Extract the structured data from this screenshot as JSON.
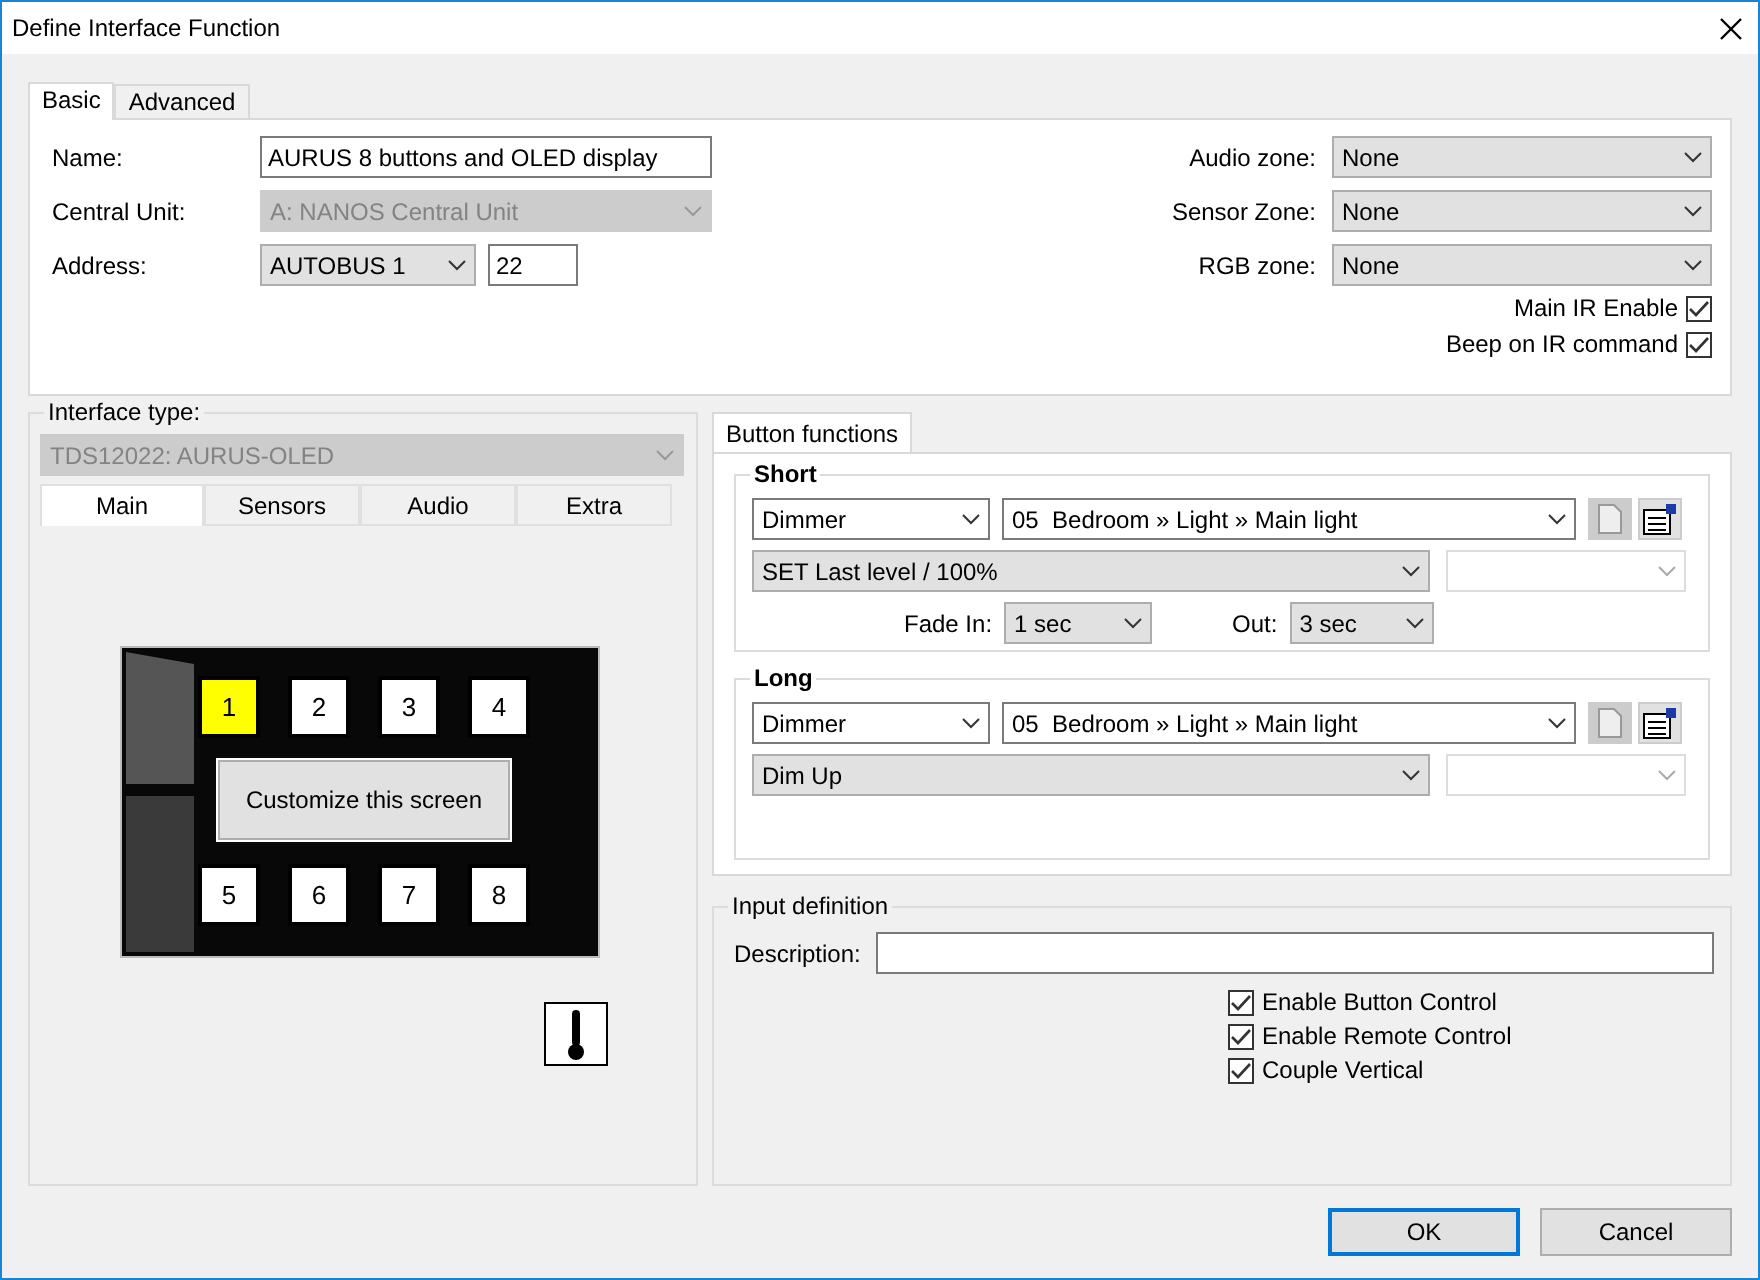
{
  "window": {
    "title": "Define Interface Function"
  },
  "tabs": [
    {
      "label": "Basic",
      "selected": true
    },
    {
      "label": "Advanced",
      "selected": false
    }
  ],
  "general": {
    "name": {
      "label": "Name:",
      "value": "AURUS 8 buttons and OLED display"
    },
    "central_unit": {
      "label": "Central Unit:",
      "value": "A: NANOS Central Unit",
      "disabled": true
    },
    "address": {
      "label": "Address:",
      "bus": "AUTOBUS 1",
      "number": "22"
    }
  },
  "zones": [
    {
      "label": "Audio zone:",
      "value": "None"
    },
    {
      "label": "Sensor Zone:",
      "value": "None"
    },
    {
      "label": "RGB zone:",
      "value": "None"
    }
  ],
  "options": [
    {
      "label": "Main IR Enable",
      "checked": true
    },
    {
      "label": "Beep on IR command",
      "checked": true
    }
  ],
  "interface_type": {
    "legend": "Interface type:",
    "value": "TDS12022: AURUS-OLED",
    "disabled": true
  },
  "device_tabs": [
    {
      "label": "Main",
      "selected": true
    },
    {
      "label": "Sensors",
      "selected": false
    },
    {
      "label": "Audio",
      "selected": false
    },
    {
      "label": "Extra",
      "selected": false
    }
  ],
  "device": {
    "keys": [
      {
        "label": "1",
        "selected": true
      },
      {
        "label": "2",
        "selected": false
      },
      {
        "label": "3",
        "selected": false
      },
      {
        "label": "4",
        "selected": false
      },
      {
        "label": "5",
        "selected": false
      },
      {
        "label": "6",
        "selected": false
      },
      {
        "label": "7",
        "selected": false
      },
      {
        "label": "8",
        "selected": false
      }
    ],
    "customize_button": "Customize this screen"
  },
  "button_functions": {
    "tab": "Button functions",
    "groups": [
      {
        "title": "Short",
        "type": "Dimmer",
        "target": "05  Bedroom » Light » Main light",
        "action": "SET Last level / 100%",
        "fade": {
          "in_label": "Fade In:",
          "in": "1 sec",
          "out_label": "Out:",
          "out": "3 sec"
        }
      },
      {
        "title": "Long",
        "type": "Dimmer",
        "target": "05  Bedroom » Light » Main light",
        "action": "Dim Up"
      }
    ]
  },
  "input_definition": {
    "legend": "Input definition",
    "description_label": "Description:",
    "checkboxes": [
      {
        "label": "Enable Button Control",
        "checked": true
      },
      {
        "label": "Enable Remote Control",
        "checked": true
      },
      {
        "label": "Couple Vertical",
        "checked": true
      }
    ]
  },
  "buttons": [
    {
      "label": "OK",
      "default": true
    },
    {
      "label": "Cancel",
      "default": false
    }
  ]
}
